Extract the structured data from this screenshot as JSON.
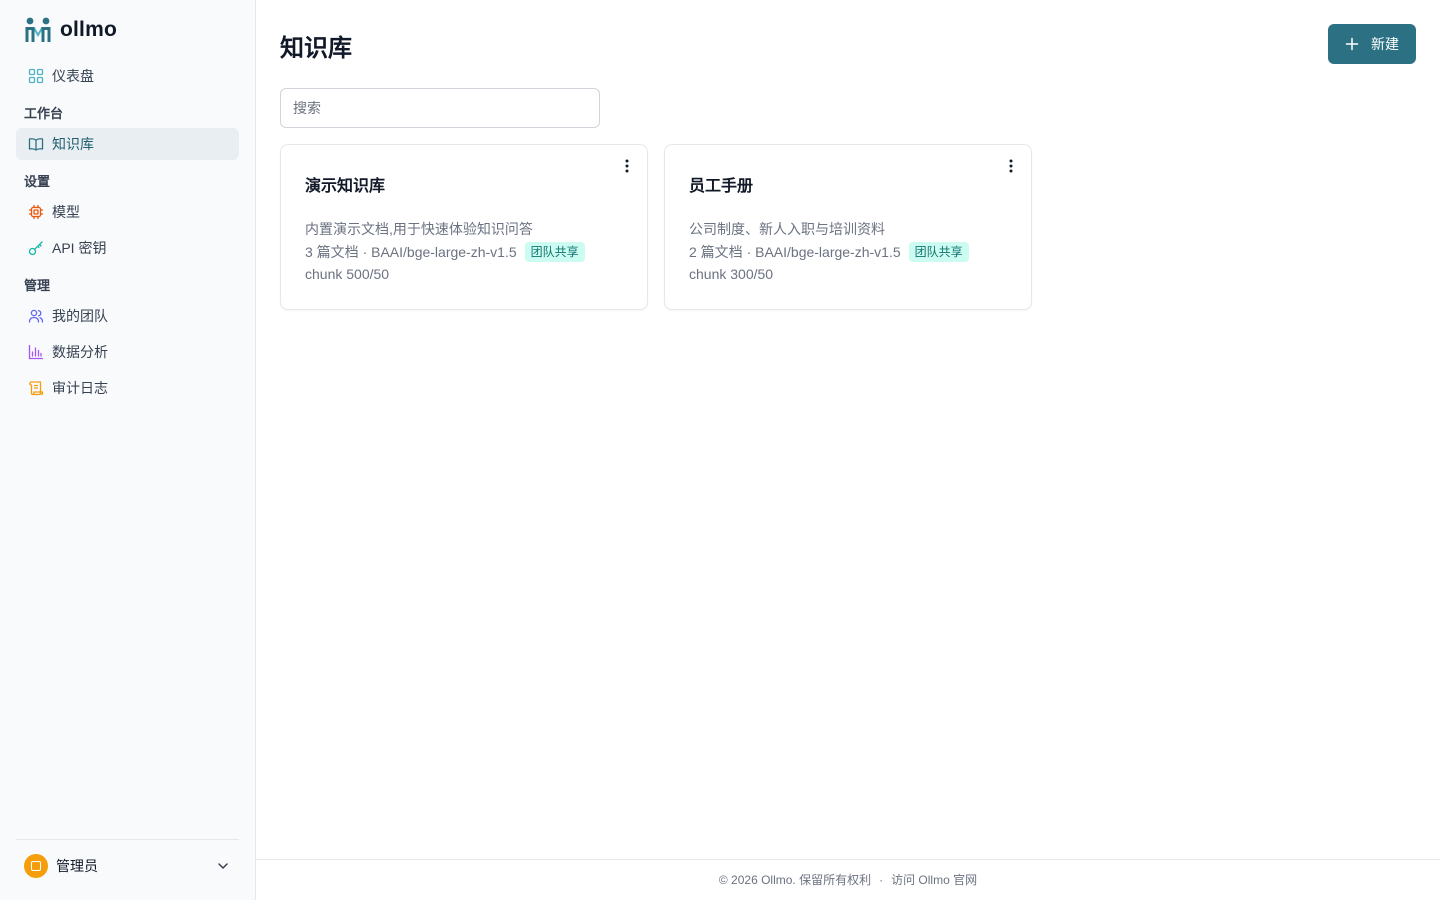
{
  "app": {
    "name": "ollmo"
  },
  "colors": {
    "accent": "#2c7183",
    "active_bg": "#e8eef2",
    "badge_bg": "#ccfbf1",
    "badge_text": "#0f766e",
    "avatar": "#f59e0b"
  },
  "sidebar": {
    "dashboard": {
      "label": "仪表盘",
      "icon": "grid-icon"
    },
    "sections": {
      "workbench": "工作台",
      "settings": "设置",
      "admin": "管理"
    },
    "knowledge_base": {
      "label": "知识库",
      "icon": "book-icon"
    },
    "models": {
      "label": "模型",
      "icon": "chip-icon"
    },
    "api_keys": {
      "label": "API 密钥",
      "icon": "key-icon"
    },
    "my_team": {
      "label": "我的团队",
      "icon": "users-icon"
    },
    "analytics": {
      "label": "数据分析",
      "icon": "bar-chart-icon"
    },
    "audit_log": {
      "label": "审计日志",
      "icon": "scroll-icon"
    },
    "user": {
      "name": "管理员",
      "icon": "chevron-down-icon"
    }
  },
  "main": {
    "title": "知识库",
    "new_button": "新建",
    "search_placeholder": "搜索",
    "cards": [
      {
        "title": "演示知识库",
        "description": "内置演示文档,用于快速体验知识问答",
        "meta": "3 篇文档 · BAAI/bge-large-zh-v1.5",
        "badge": "团队共享",
        "chunk": "chunk 500/50"
      },
      {
        "title": "员工手册",
        "description": "公司制度、新人入职与培训资料",
        "meta": "2 篇文档 · BAAI/bge-large-zh-v1.5",
        "badge": "团队共享",
        "chunk": "chunk 300/50"
      }
    ]
  },
  "footer": {
    "copyright": "© 2026 Ollmo. 保留所有权利",
    "separator": "·",
    "link": "访问 Ollmo 官网"
  }
}
